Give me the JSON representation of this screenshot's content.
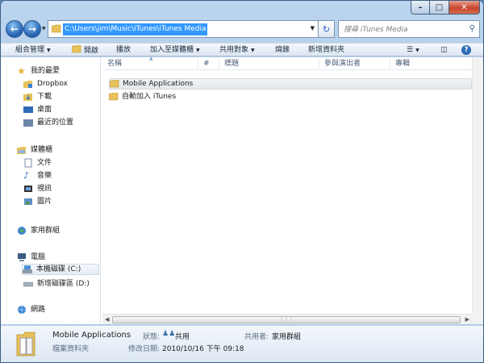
{
  "address": {
    "path": "C:\\Users\\jim\\Music\\iTunes\\iTunes Media"
  },
  "search": {
    "placeholder": "搜尋 iTunes Media"
  },
  "toolbar": {
    "organize": "組合管理",
    "open": "開啟",
    "play": "播放",
    "add_to_library": "加入至媒體櫃",
    "share_with": "共用對象",
    "burn": "燒錄",
    "new_folder": "新增資料夾"
  },
  "nav": {
    "favorites": "我的最愛",
    "dropbox": "Dropbox",
    "downloads": "下載",
    "desktop": "桌面",
    "recent": "最近的位置",
    "libraries": "媒體櫃",
    "documents": "文件",
    "music": "音樂",
    "videos": "視訊",
    "pictures": "圖片",
    "homegroup": "家用群組",
    "computer": "電腦",
    "drive_c": "本機磁碟 (C:)",
    "drive_d": "新增磁碟區 (D:)",
    "network": "網路"
  },
  "columns": {
    "name": "名稱",
    "number": "#",
    "title": "標題",
    "artists": "參與演出者",
    "album": "專輯"
  },
  "files": [
    {
      "name": "Mobile Applications"
    },
    {
      "name": "自動加入 iTunes"
    }
  ],
  "details": {
    "name": "Mobile Applications",
    "type": "檔案資料夾",
    "state_label": "狀態:",
    "state_value": "共用",
    "date_label": "修改日期:",
    "date_value": "2010/10/16 下午 09:18",
    "shared_label": "共用者:",
    "shared_value": "家用群組"
  },
  "colors": {
    "selection": "#3399ff",
    "folder": "#e8c25a",
    "chrome": "#bcd5ee"
  }
}
